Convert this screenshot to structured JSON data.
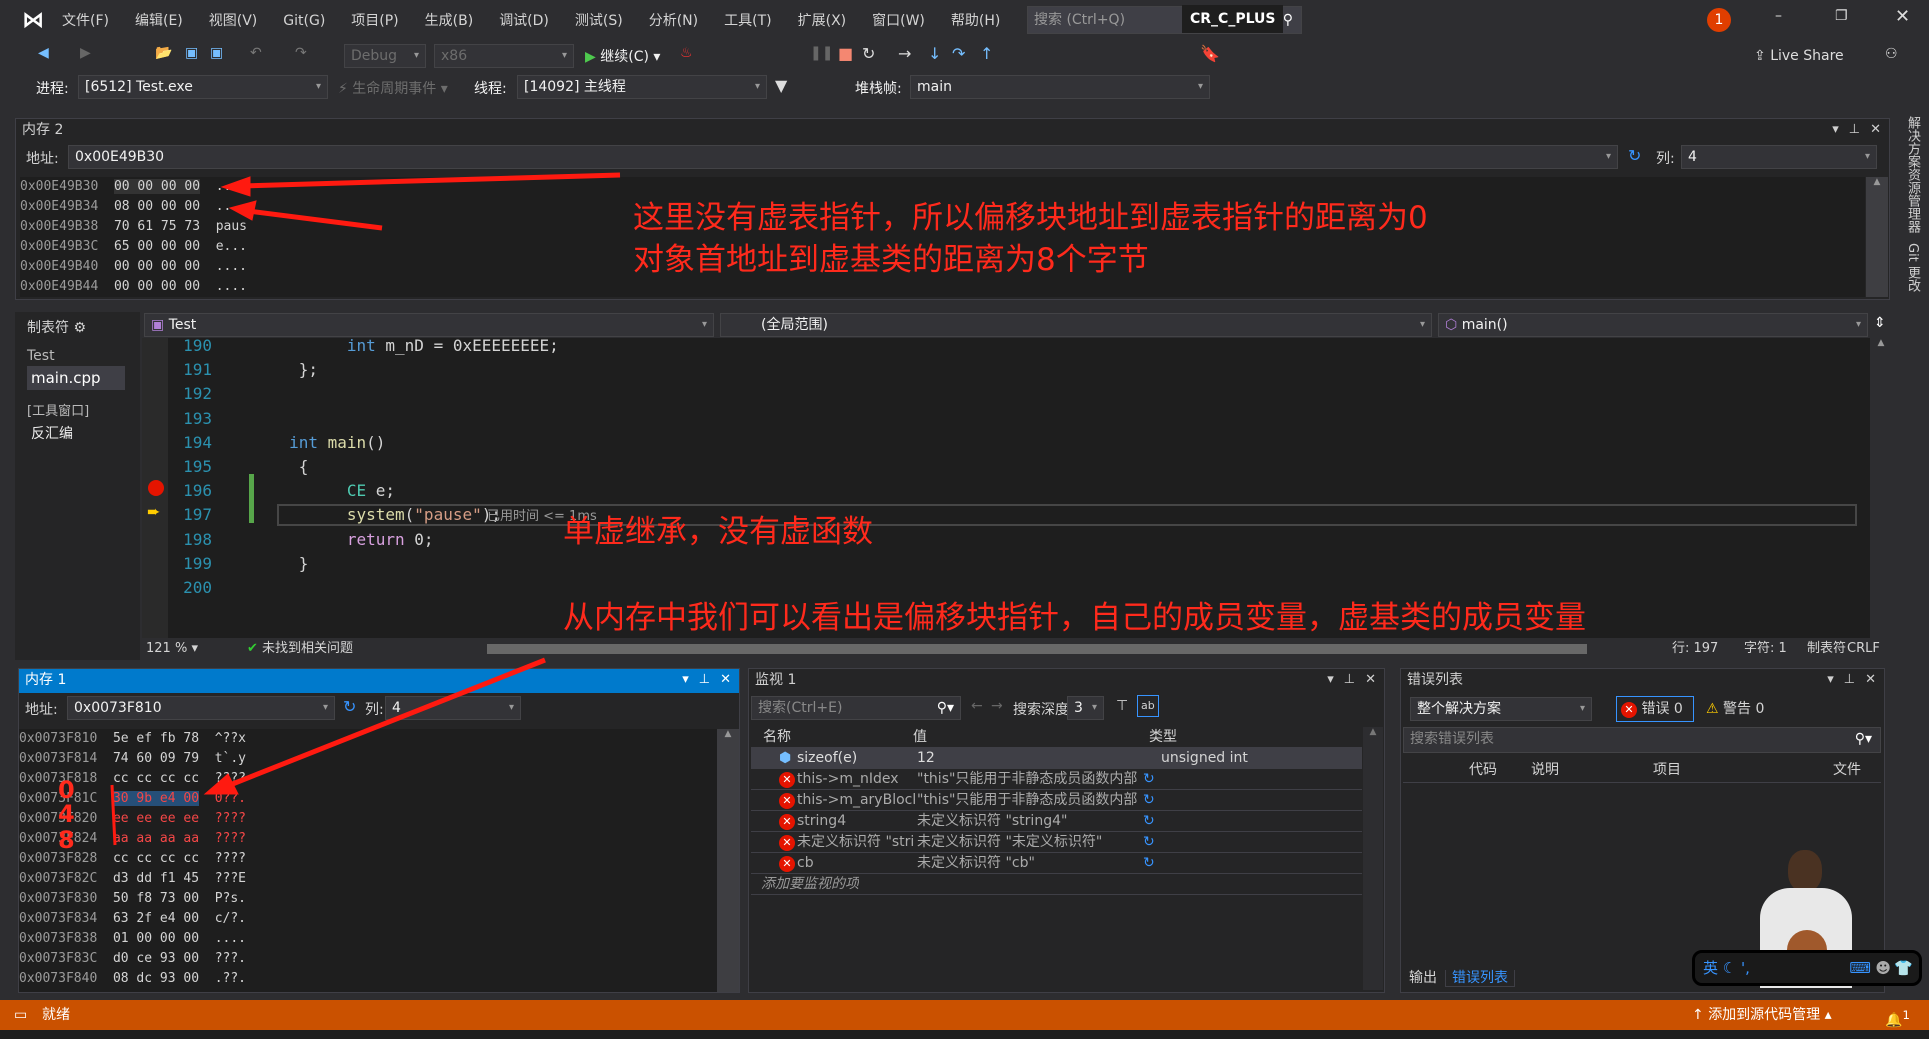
{
  "titlebar": {
    "menus": [
      "文件(F)",
      "编辑(E)",
      "视图(V)",
      "Git(G)",
      "项目(P)",
      "生成(B)",
      "调试(D)",
      "测试(S)",
      "分析(N)",
      "工具(T)",
      "扩展(X)",
      "窗口(W)",
      "帮助(H)"
    ],
    "search_placeholder": "搜索 (Ctrl+Q)",
    "solution": "CR_C_PLUS",
    "notification_count": "1"
  },
  "toolbar": {
    "config": "Debug",
    "platform": "x86",
    "continue": "继续(C)",
    "live_share": "Live Share"
  },
  "debugbar": {
    "process_label": "进程:",
    "process": "[6512] Test.exe",
    "lifecycle": "生命周期事件",
    "thread_label": "线程:",
    "thread": "[14092] 主线程",
    "stack_label": "堆栈帧:",
    "stack": "main"
  },
  "memory2": {
    "title": "内存 2",
    "address_label": "地址:",
    "address": "0x00E49B30",
    "cols_label": "列:",
    "cols": "4",
    "rows": [
      [
        "0x00E49B30",
        "00 00 00 00",
        "...."
      ],
      [
        "0x00E49B34",
        "08 00 00 00",
        ".."
      ],
      [
        "0x00E49B38",
        "70 61 75 73",
        "paus"
      ],
      [
        "0x00E49B3C",
        "65 00 00 00",
        "e..."
      ],
      [
        "0x00E49B40",
        "00 00 00 00",
        "...."
      ],
      [
        "0x00E49B44",
        "00 00 00 00",
        "...."
      ]
    ]
  },
  "side_tabs": [
    "解决方案资源管理器",
    "Git 更改"
  ],
  "annotations": {
    "note1": "这里没有虚表指针，所以偏移块地址到虚表指针的距离为0",
    "note2": "对象首地址到虚基类的距离为8个字节",
    "note3": "单虚继承，没有虚函数",
    "note4": "从内存中我们可以看出是偏移块指针，自己的成员变量，虚基类的成员变量",
    "hand_numbers": [
      "0",
      "4",
      "8"
    ]
  },
  "tabpane": {
    "title": "制表符",
    "project": "Test",
    "file": "main.cpp",
    "tool_window": "[工具窗口]",
    "disasm": "反汇编"
  },
  "editor": {
    "project_combo": "Test",
    "scope_combo": "(全局范围)",
    "func_combo": "main()",
    "lines": [
      {
        "n": "190",
        "code": "int m_nD = 0xEEEEEEEE;"
      },
      {
        "n": "191",
        "code": "};"
      },
      {
        "n": "192",
        "code": ""
      },
      {
        "n": "193",
        "code": ""
      },
      {
        "n": "194",
        "code": "int main()"
      },
      {
        "n": "195",
        "code": "{"
      },
      {
        "n": "196",
        "code": "CE e;"
      },
      {
        "n": "197",
        "code": "system(\"pause\");"
      },
      {
        "n": "198",
        "code": "return 0;"
      },
      {
        "n": "199",
        "code": "}"
      },
      {
        "n": "200",
        "code": ""
      }
    ],
    "elapsed": "已用时间 <= 1ms",
    "zoom": "121 %",
    "issues": "未找到相关问题",
    "row": "行: 197",
    "char": "字符: 1",
    "tabs": "制表符",
    "eol": "CRLF"
  },
  "memory1": {
    "title": "内存 1",
    "address_label": "地址:",
    "address": "0x0073F810",
    "cols_label": "列:",
    "cols": "4",
    "rows": [
      [
        "0x0073F810",
        "5e ef fb 78",
        "^??x"
      ],
      [
        "0x0073F814",
        "74 60 09 79",
        "t`.y"
      ],
      [
        "0x0073F818",
        "cc cc cc cc",
        "????"
      ],
      [
        "0x0073F81C",
        "30 9b e4 00",
        "0??."
      ],
      [
        "0x0073F820",
        "ee ee ee ee",
        "????"
      ],
      [
        "0x0073F824",
        "aa aa aa aa",
        "????"
      ],
      [
        "0x0073F828",
        "cc cc cc cc",
        "????"
      ],
      [
        "0x0073F82C",
        "d3 dd f1 45",
        "???E"
      ],
      [
        "0x0073F830",
        "50 f8 73 00",
        "P?s."
      ],
      [
        "0x0073F834",
        "63 2f e4 00",
        "c/?."
      ],
      [
        "0x0073F838",
        "01 00 00 00",
        "...."
      ],
      [
        "0x0073F83C",
        "d0 ce 93 00",
        "???."
      ],
      [
        "0x0073F840",
        "08 dc 93 00",
        ".??."
      ]
    ]
  },
  "watch": {
    "title": "监视 1",
    "search_placeholder": "搜索(Ctrl+E)",
    "depth_label": "搜索深度:",
    "depth": "3",
    "headers": [
      "名称",
      "值",
      "类型"
    ],
    "rows": [
      {
        "name": "sizeof(e)",
        "value": "12",
        "type": "unsigned int",
        "error": false
      },
      {
        "name": "this->m_nIdex",
        "value": "\"this\"只能用于非静态成员函数内部",
        "type": "",
        "error": true
      },
      {
        "name": "this->m_aryBlock",
        "value": "\"this\"只能用于非静态成员函数内部",
        "type": "",
        "error": true
      },
      {
        "name": "string4",
        "value": "未定义标识符 \"string4\"",
        "type": "",
        "error": true
      },
      {
        "name": "未定义标识符 \"string...",
        "value": "未定义标识符 \"未定义标识符\"",
        "type": "",
        "error": true
      },
      {
        "name": "cb",
        "value": "未定义标识符 \"cb\"",
        "type": "",
        "error": true
      }
    ],
    "add_item": "添加要监视的项"
  },
  "errorlist": {
    "title": "错误列表",
    "scope": "整个解决方案",
    "errors": "错误 0",
    "warnings": "警告 0",
    "search_placeholder": "搜索错误列表",
    "headers": [
      "代码",
      "说明",
      "项目",
      "文件"
    ],
    "bottom_tabs": [
      "输出",
      "错误列表"
    ]
  },
  "ime": {
    "lang": "英"
  },
  "statusbar": {
    "state": "就绪",
    "source_control": "添加到源代码管理",
    "bell_count": "1",
    "color": "#ca5100"
  }
}
